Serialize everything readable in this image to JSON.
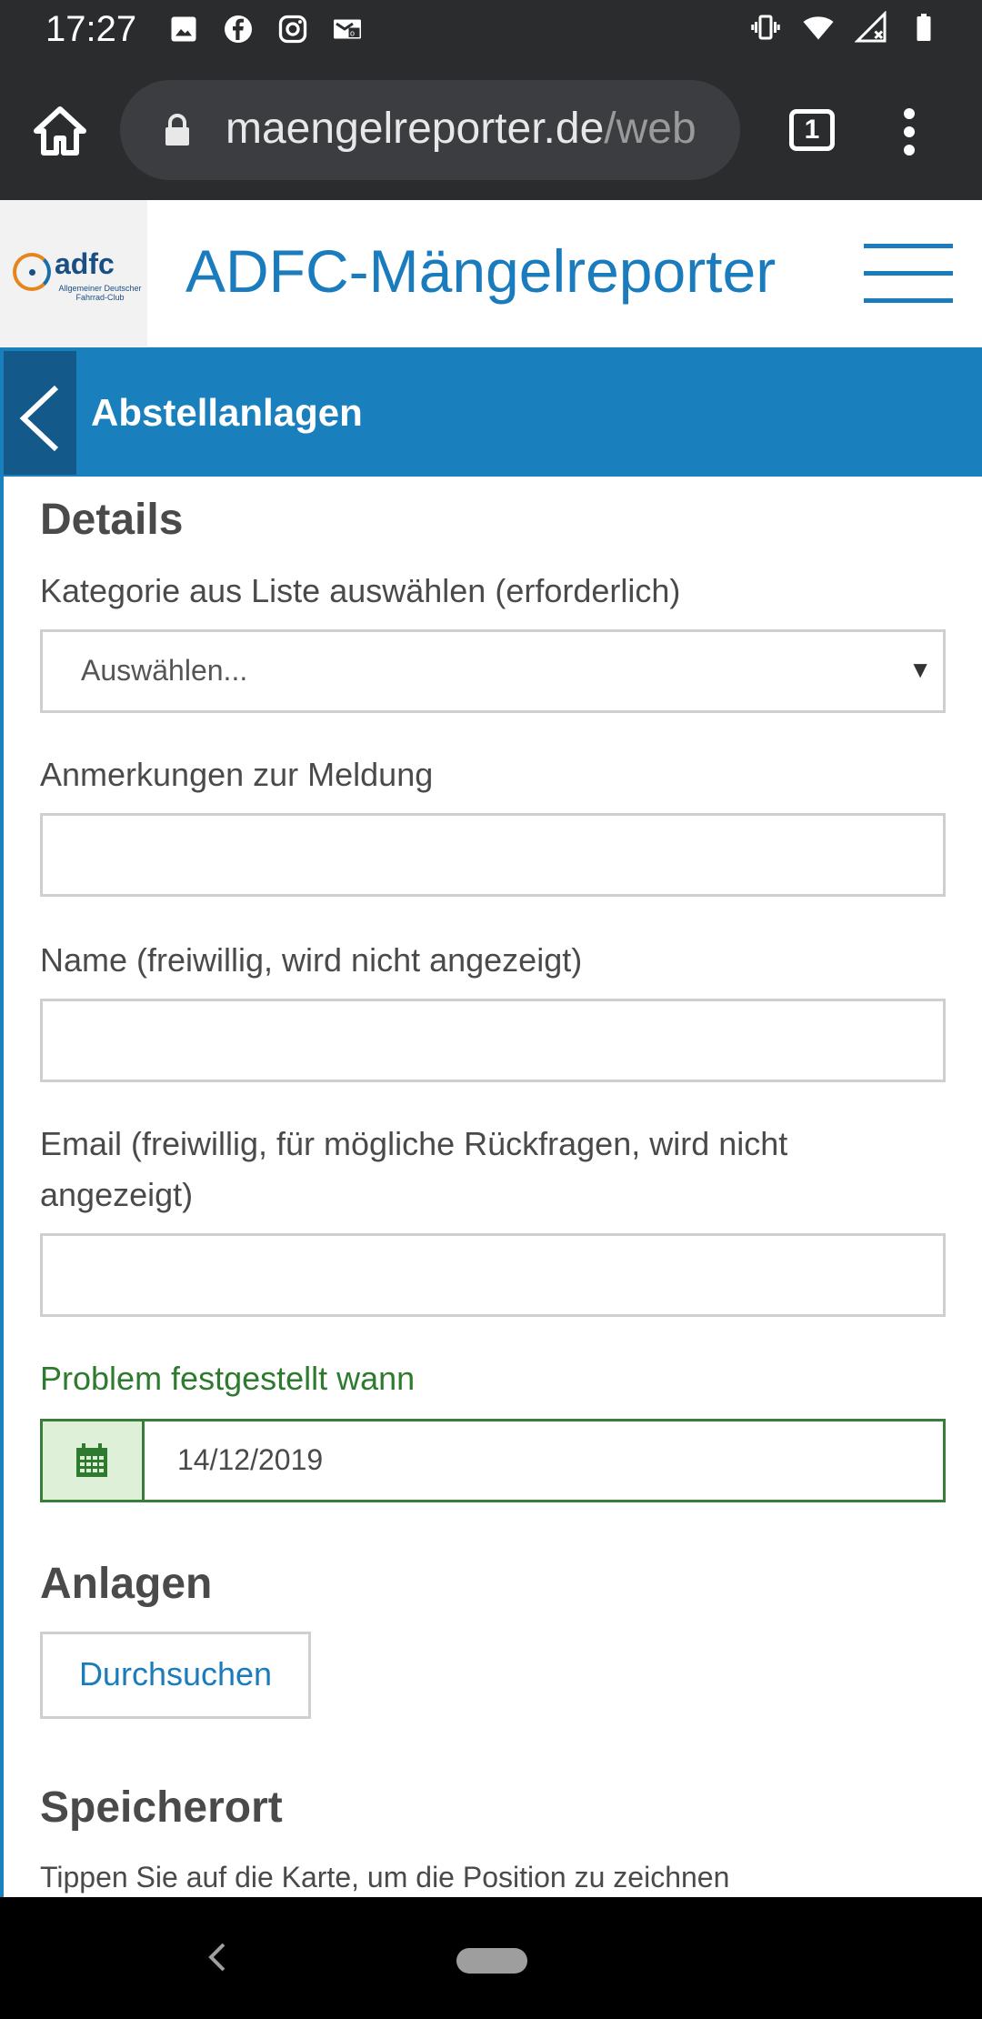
{
  "status_bar": {
    "time": "17:27",
    "left_icons": [
      "image-icon",
      "facebook-icon",
      "instagram-icon",
      "mail-icon"
    ],
    "right_icons": [
      "vibrate-icon",
      "wifi-icon",
      "signal-icon",
      "battery-icon"
    ]
  },
  "browser": {
    "url_main": "maengelreporter.de",
    "url_rest": "/web",
    "tab_count": "1"
  },
  "site": {
    "logo_word": "adfc",
    "logo_sub": "Allgemeiner Deutscher Fahrrad-Club",
    "title": "ADFC-Mängelreporter"
  },
  "subheader": {
    "title": "Abstellanlagen"
  },
  "form": {
    "details_heading": "Details",
    "category_label": "Kategorie aus Liste auswählen (erforderlich)",
    "category_value": "Auswählen...",
    "notes_label": "Anmerkungen zur Meldung",
    "notes_value": "",
    "name_label": "Name (freiwillig, wird nicht angezeigt)",
    "name_value": "",
    "email_label": "Email (freiwillig, für mögliche Rückfragen, wird nicht angezeigt)",
    "email_value": "",
    "date_label": "Problem festgestellt wann",
    "date_value": "14/12/2019",
    "attachments_heading": "Anlagen",
    "browse_label": "Durchsuchen",
    "location_heading": "Speicherort",
    "location_hint": "Tippen Sie auf die Karte, um die Position zu zeichnen"
  },
  "colors": {
    "brand_blue": "#1a7fbd",
    "brand_dark_blue": "#135a8a",
    "success_green": "#3a7d3a"
  }
}
